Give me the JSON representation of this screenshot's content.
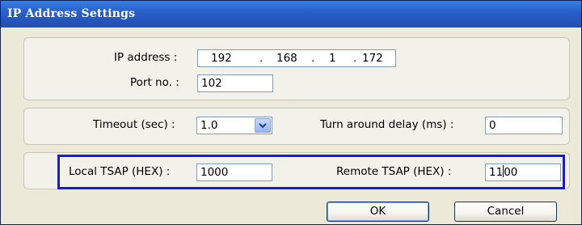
{
  "window": {
    "title": "IP Address Settings"
  },
  "network": {
    "ip_label": "IP address :",
    "ip": [
      "192",
      "168",
      "1",
      "172"
    ],
    "ip_dot": ".",
    "port_label": "Port no. :",
    "port": "102"
  },
  "timing": {
    "timeout_label": "Timeout (sec) :",
    "timeout": "1.0",
    "delay_label": "Turn around delay (ms) :",
    "delay": "0"
  },
  "tsap": {
    "local_label": "Local TSAP (HEX) :",
    "local": "1000",
    "remote_label": "Remote TSAP (HEX) :",
    "remote_before_cursor": "11",
    "remote_after_cursor": "00"
  },
  "buttons": {
    "ok": "OK",
    "cancel": "Cancel"
  },
  "colors": {
    "title_bar": "#2a5fc8",
    "highlight": "#1a1ad6"
  },
  "icons": {
    "timeout_dropdown": "chevron-down-icon"
  }
}
